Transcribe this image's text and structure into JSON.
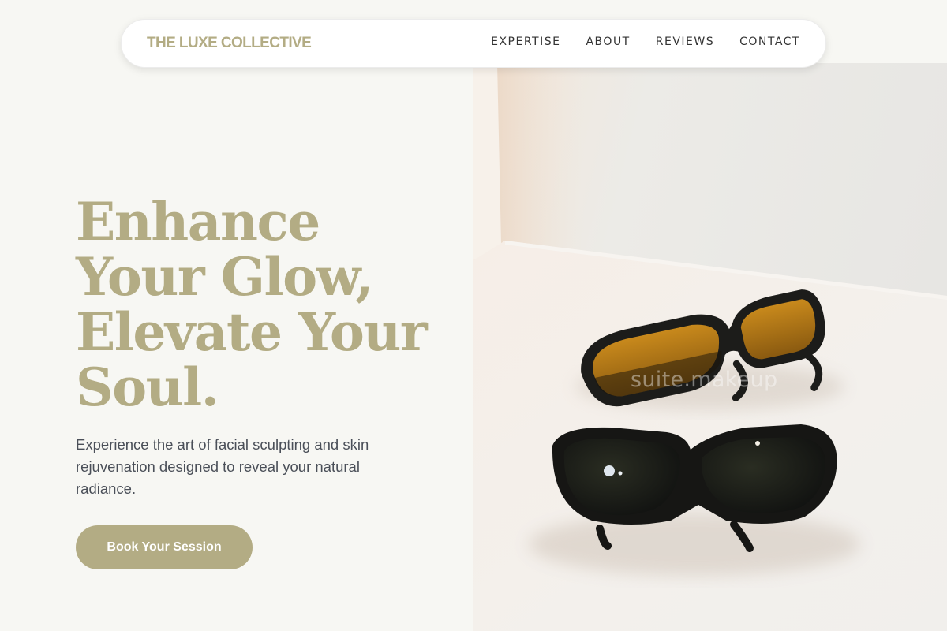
{
  "nav": {
    "brand": "THE LUXE COLLECTIVE",
    "links": [
      {
        "label": "EXPERTISE"
      },
      {
        "label": "ABOUT"
      },
      {
        "label": "REVIEWS"
      },
      {
        "label": "CONTACT"
      }
    ]
  },
  "hero": {
    "title_lines": [
      "Enhance",
      "Your Glow,",
      "Elevate Your",
      "Soul."
    ],
    "subtitle": "Experience the art of facial sculpting and skin rejuvenation designed to reveal your natural radiance.",
    "cta_label": "Book Your Session",
    "image": {
      "alt": "Two pairs of protective eyewear, one with amber lenses and one with dark lenses",
      "watermark": "suite.makeup"
    }
  },
  "colors": {
    "accent": "#b3ac84",
    "page_bg": "#f7f7f3",
    "body_text": "#4a4f58",
    "nav_text": "#333333"
  }
}
